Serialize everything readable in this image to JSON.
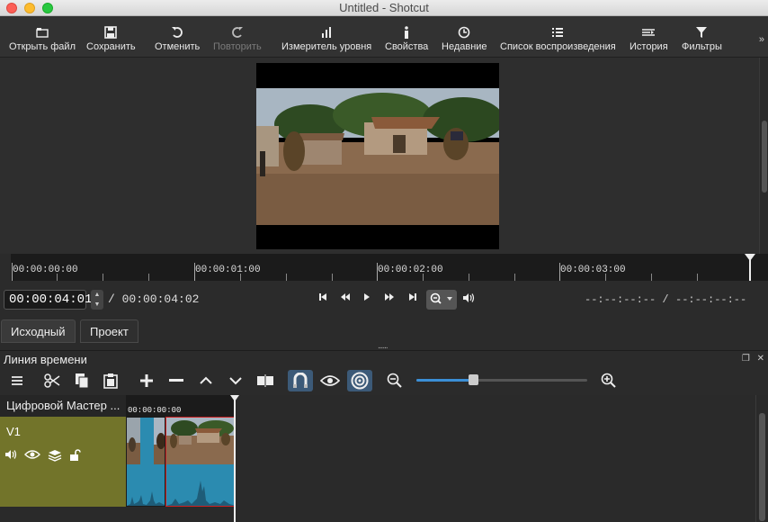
{
  "window": {
    "title": "Untitled - Shotcut"
  },
  "toolbar": {
    "open": "Открыть файл",
    "save": "Сохранить",
    "undo": "Отменить",
    "redo": "Повторить",
    "meter": "Измеритель уровня",
    "properties": "Свойства",
    "recent": "Недавние",
    "playlist": "Список воспроизведения",
    "history": "История",
    "filters": "Фильтры",
    "more": "»"
  },
  "ruler": {
    "labels": [
      "00:00:00:00",
      "00:00:01:00",
      "00:00:02:00",
      "00:00:03:00"
    ]
  },
  "transport": {
    "position": "00:00:04:01",
    "duration": "/ 00:00:04:02",
    "in_point": "--:--:--:-- /",
    "out_point": "--:--:--:--"
  },
  "tabs": {
    "source": "Исходный",
    "project": "Проект"
  },
  "splitter": "......",
  "timeline": {
    "title": "Линия времени",
    "master": "Цифровой Мастер ...",
    "track_name": "V1",
    "ruler_label": "00:00:00:00",
    "zoom": 0.33
  }
}
